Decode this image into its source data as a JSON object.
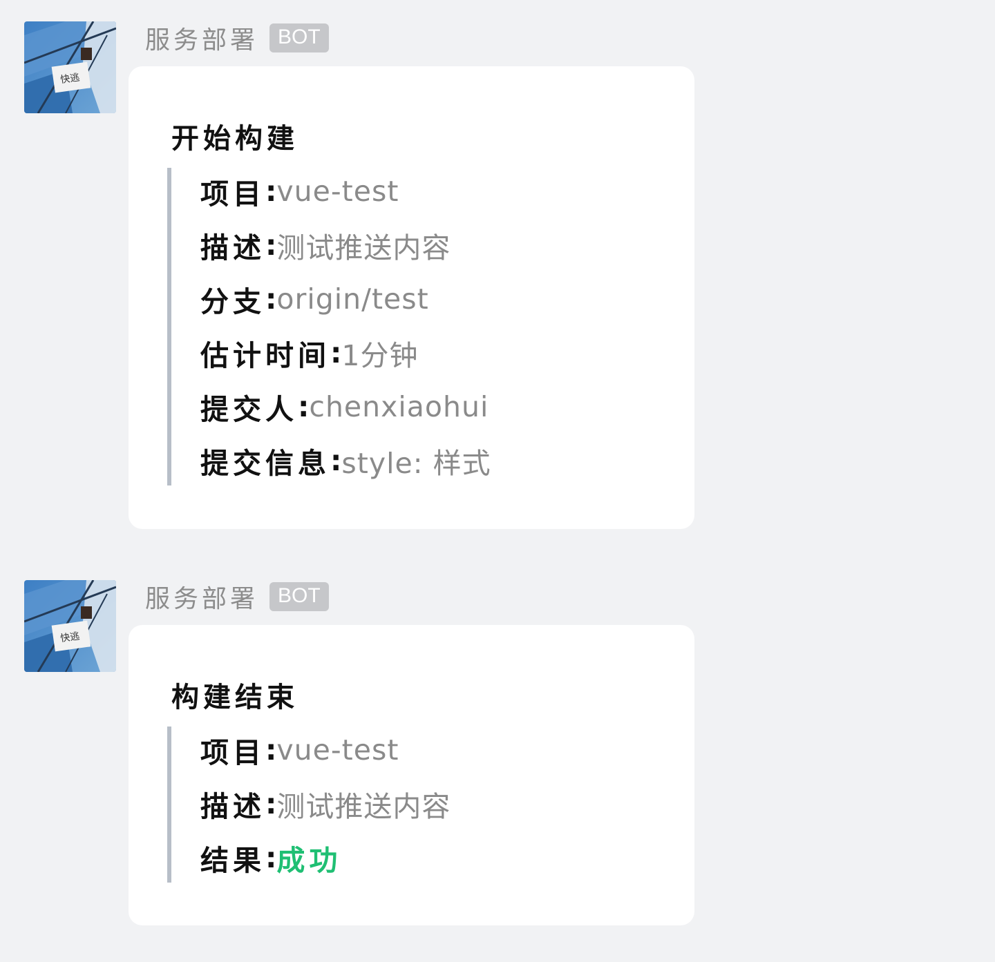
{
  "messages": [
    {
      "sender": "服务部署",
      "badge": "BOT",
      "avatar": "avatar-photo",
      "title": "开始构建",
      "fields": [
        {
          "label": "项目",
          "sep": ":",
          "value": "vue-test"
        },
        {
          "label": "描述",
          "sep": ":",
          "value": "测试推送内容"
        },
        {
          "label": "分支",
          "sep": ":",
          "value": "origin/test"
        },
        {
          "label": "估计时间",
          "sep": ":",
          "value": "1分钟"
        },
        {
          "label": "提交人",
          "sep": ":",
          "value": "chenxiaohui"
        },
        {
          "label": "提交信息",
          "sep": ":",
          "value": "style: 样式"
        }
      ]
    },
    {
      "sender": "服务部署",
      "badge": "BOT",
      "avatar": "avatar-photo",
      "title": "构建结束",
      "fields": [
        {
          "label": "项目",
          "sep": ":",
          "value": "vue-test"
        },
        {
          "label": "描述",
          "sep": ":",
          "value": "测试推送内容"
        },
        {
          "label": "结果",
          "sep": ":",
          "value": "成功",
          "status": "success"
        }
      ]
    }
  ],
  "colors": {
    "page_background": "#f1f2f4",
    "card_background": "#ffffff",
    "muted_text": "#8a8a8a",
    "quote_bar": "#b7bec8",
    "badge_background": "#c6c7ca",
    "success": "#1fbf73"
  }
}
